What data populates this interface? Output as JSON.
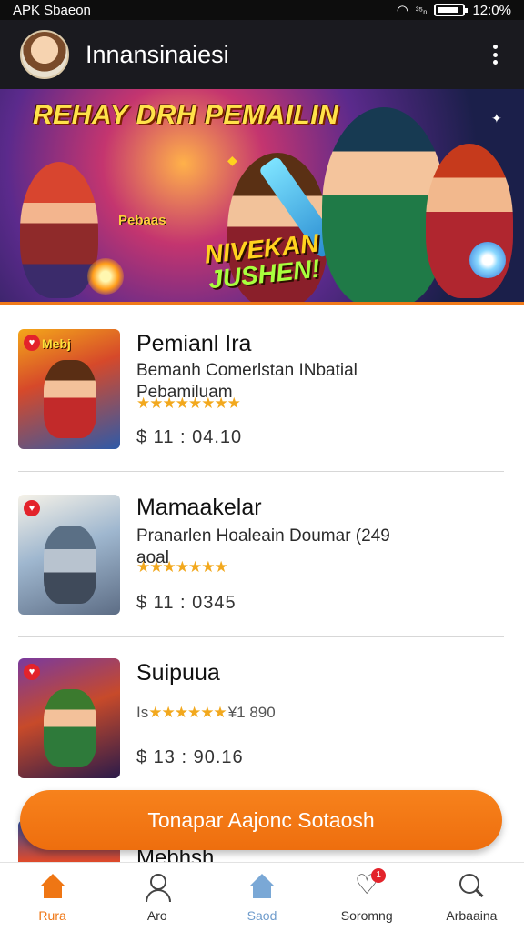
{
  "status_bar": {
    "left_text": "APK Sbaeon",
    "time": "12:0%",
    "signal_text": "³⁵ₙ"
  },
  "app_bar": {
    "title": "Innansinaiesi"
  },
  "hero": {
    "title": "REHAY DRH PEMAILIN",
    "badge": "Pebaas",
    "logo_line1": "NIVEKAN",
    "logo_line2": "JUSHEN!"
  },
  "games": [
    {
      "name": "Pemianl Ira",
      "description": "Bemanh Comerlstan INbatial Pebamiluam",
      "stars": "★★★★★★★★",
      "price": "$ 11 : 04.10",
      "thumb_text": "Mebj",
      "badge": "♥"
    },
    {
      "name": "Mamaakelar",
      "description": "Pranarlen Hoaleain Doumar (249 aoal",
      "stars": "★★★★★★★",
      "price": "$ 11 : 0345",
      "badge": "♥"
    },
    {
      "name": "Suipuua",
      "stars_prefix": "Is",
      "stars": "★★★★★★",
      "stars_suffix": "¥1 890",
      "price": "$ 13 : 90.16",
      "badge": "♥"
    }
  ],
  "cta": {
    "label": "Tonapar Aajonc Sotaosh"
  },
  "peek": {
    "name": "Mebhsh"
  },
  "bottom_nav": {
    "items": [
      {
        "label": "Rura",
        "icon": "home-icon",
        "active": true
      },
      {
        "label": "Aro",
        "icon": "user-icon"
      },
      {
        "label": "Saod",
        "icon": "shop-house-icon"
      },
      {
        "label": "Soromng",
        "icon": "heart-icon",
        "badge": "1"
      },
      {
        "label": "Arbaaina",
        "icon": "search-icon"
      }
    ]
  },
  "colors": {
    "accent": "#ef7614",
    "app_bar": "#1a1a1f",
    "star": "#f2a81d",
    "badge_red": "#e3232b"
  }
}
